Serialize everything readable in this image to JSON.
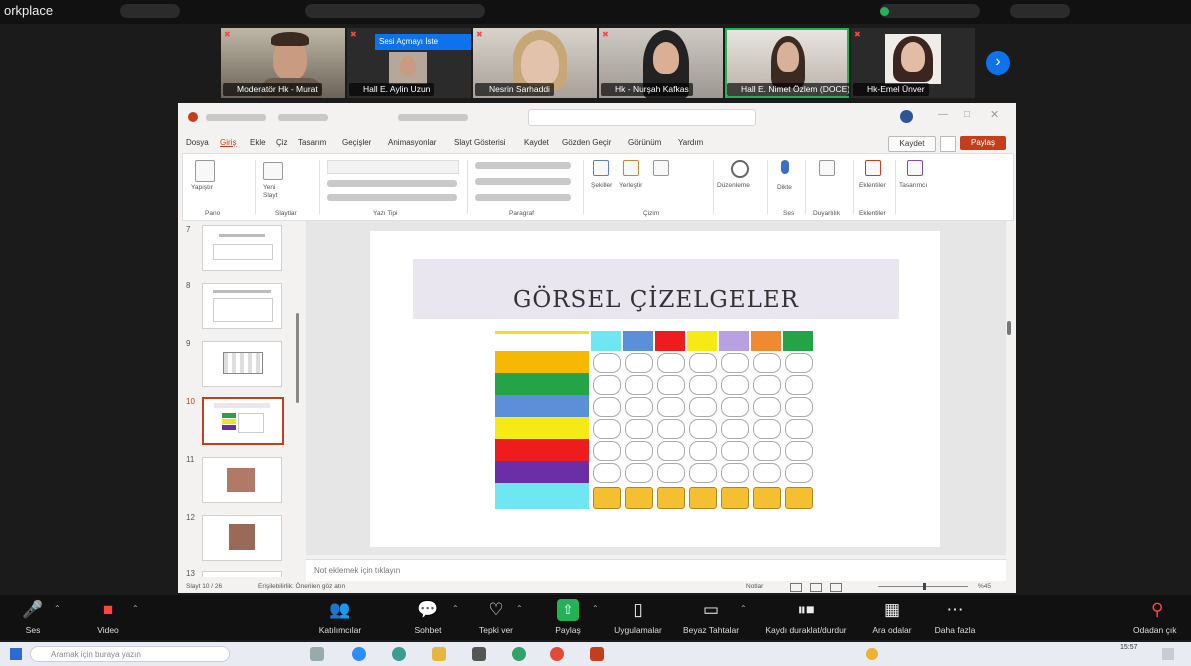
{
  "app": {
    "brand": "orkplace"
  },
  "strip": {
    "participants": [
      {
        "name": "Moderatör Hk - Murat"
      },
      {
        "name": "Hall E. Aylin Uzun",
        "banner": "Sesi Açmayı İste"
      },
      {
        "name": "Nesrin Sarhaddi"
      },
      {
        "name": "Hk - Nurşah Kafkas"
      },
      {
        "name": "Hall E. Nimet Özlem (DOCE)"
      },
      {
        "name": "Hk-Emel Ünver"
      }
    ]
  },
  "ppt": {
    "menu": [
      "Dosya",
      "Giriş",
      "Ekle",
      "Çiz",
      "Tasarım",
      "Geçişler",
      "Animasyonlar",
      "Slayt Gösterisi",
      "Kaydet",
      "Gözden Geçir",
      "Görünüm",
      "Yardım"
    ],
    "save_label": "Kaydet",
    "share_label": "Paylaş",
    "ribbon_groups": [
      "Pano",
      "Slaytlar",
      "Yazı Tipi",
      "Paragraf",
      "Çizim",
      "Ses",
      "Duyarlılık",
      "Eklentiler"
    ],
    "ribbon_buttons": [
      "Yapıştır",
      "Yeni Slayt",
      "Şekiller",
      "Yerleştir",
      "Düzenleme",
      "Dikte",
      "Eklentiler",
      "Tasarımcı"
    ],
    "thumb_numbers": [
      "7",
      "8",
      "9",
      "10",
      "11",
      "12",
      "13"
    ],
    "slide_title": "GÖRSEL ÇİZELGELER",
    "notes_placeholder": "Not eklemek için tıklayın",
    "status_left": "Slayt 10 / 26",
    "status_access": "Erişilebilirlik: Önerilen göz atın",
    "status_notes": "Notlar",
    "status_zoom": "%45"
  },
  "toolbar": {
    "items": [
      {
        "label": "Ses"
      },
      {
        "label": "Video"
      },
      {
        "label": "Katılımcılar"
      },
      {
        "label": "Sohbet"
      },
      {
        "label": "Tepki ver"
      },
      {
        "label": "Paylaş"
      },
      {
        "label": "Uygulamalar"
      },
      {
        "label": "Beyaz Tahtalar"
      },
      {
        "label": "Kaydı duraklat/durdur"
      },
      {
        "label": "Ara odalar"
      },
      {
        "label": "Daha fazla"
      },
      {
        "label": "Odadan çık"
      }
    ]
  },
  "taskbar": {
    "search_placeholder": "Aramak için buraya yazın",
    "time": "15:57"
  },
  "colors": {
    "accent": "#c43e1c",
    "zoom_blue": "#0e72ed",
    "share_green": "#23b257"
  }
}
